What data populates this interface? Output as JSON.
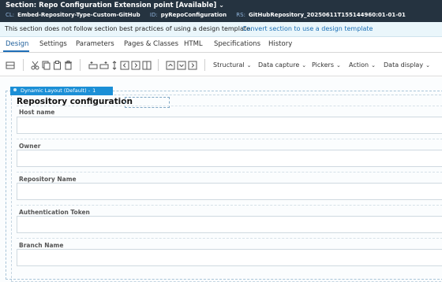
{
  "header": {
    "title": "Section: Repo Configuration Extension point [Available]",
    "caret": "⌄",
    "meta": [
      {
        "key": "CL:",
        "value": "Embed-Repository-Type-Custom-GitHub"
      },
      {
        "key": "ID:",
        "value": "pyRepoConfiguration"
      },
      {
        "key": "RS:",
        "value": "GitHubRepository_20250611T155144960:01-01-01"
      }
    ]
  },
  "info_bar": {
    "message": "This section does not follow section best practices of using a design template.",
    "link": "Convert section to use a design template"
  },
  "tabs": [
    "Design",
    "Settings",
    "Parameters",
    "Pages & Classes",
    "HTML",
    "Specifications",
    "History"
  ],
  "toolbar": {
    "menus": [
      "Structural",
      "Data capture",
      "Pickers",
      "Action",
      "Data display"
    ]
  },
  "canvas": {
    "layout_tag": "Dynamic Layout (Default) -",
    "layout_index": "1",
    "section_title": "Repository configuration",
    "fields": [
      "Host name",
      "Owner",
      "Repository Name",
      "Authentication Token",
      "Branch Name"
    ]
  }
}
